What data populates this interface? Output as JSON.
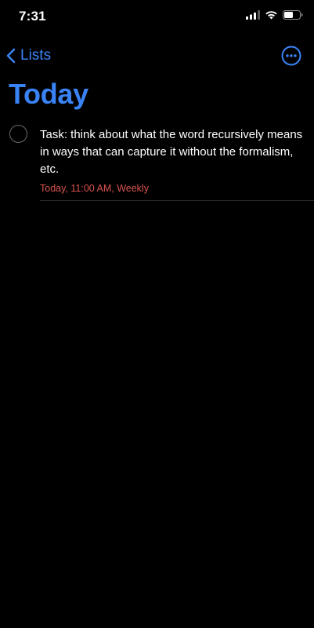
{
  "status_bar": {
    "time": "7:31",
    "signal_icon": "cellular-signal-icon",
    "wifi_icon": "wifi-icon",
    "battery_icon": "battery-icon"
  },
  "nav": {
    "back_label": "Lists",
    "back_icon": "chevron-left-icon",
    "more_icon": "ellipsis-circle-icon"
  },
  "page": {
    "title": "Today"
  },
  "reminders": [
    {
      "title": "Task: think about what the word recursively means in ways that can capture it without the formalism, etc.",
      "meta": "Today, 11:00 AM, Weekly",
      "completed": false
    }
  ],
  "colors": {
    "accent": "#3a83f6",
    "due_text": "#d9534f",
    "background": "#000000",
    "checkbox_border": "#6b6b6e",
    "divider": "#2a2a2c"
  }
}
